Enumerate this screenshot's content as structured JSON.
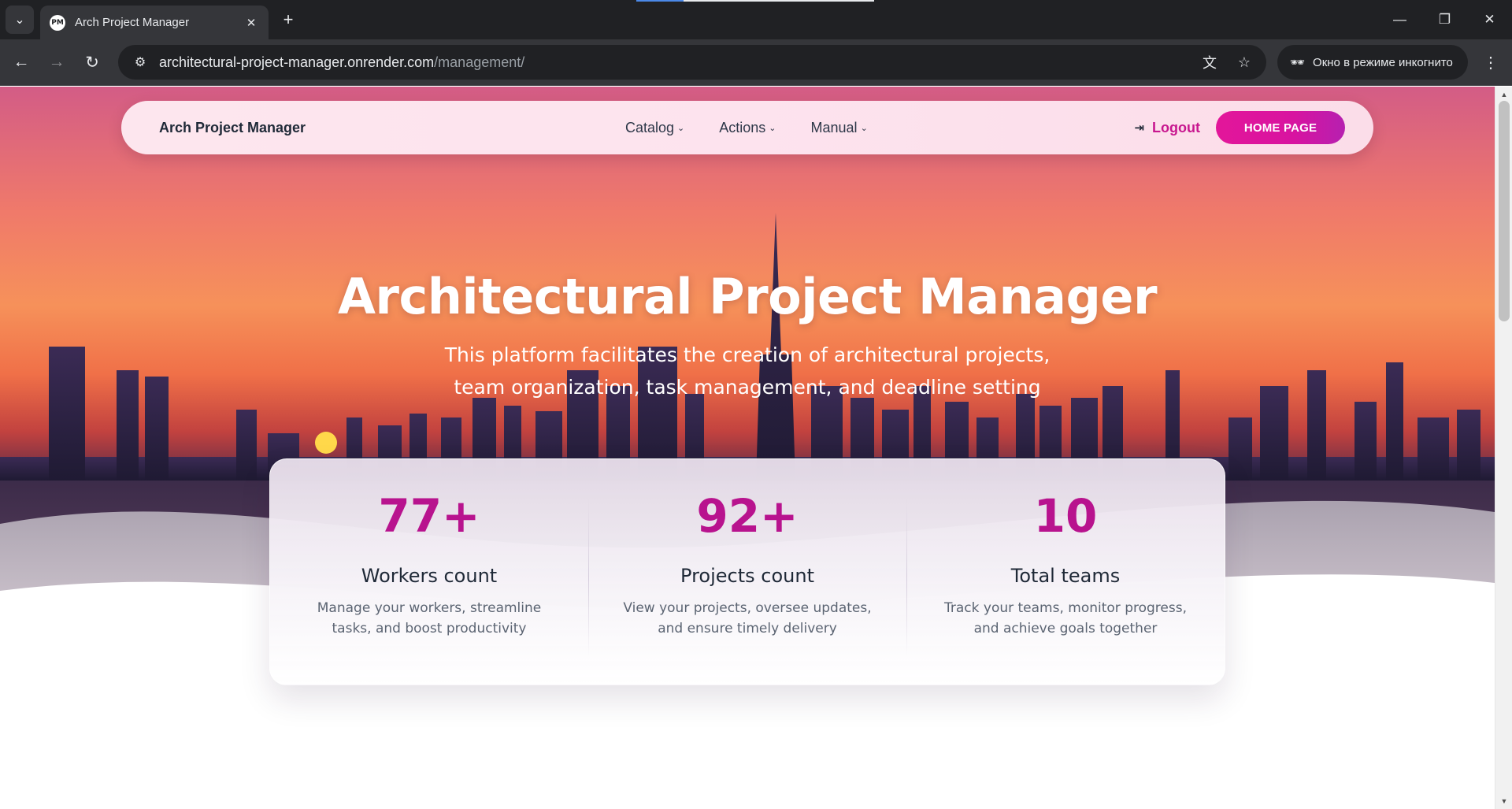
{
  "browser": {
    "tab_title": "Arch Project Manager",
    "tab_favicon_text": "PM",
    "url_host": "architectural-project-manager.onrender.com",
    "url_path": "/management/",
    "incognito_label": "Окно в режиме инкогнито"
  },
  "navbar": {
    "brand": "Arch Project Manager",
    "menu": [
      {
        "label": "Catalog"
      },
      {
        "label": "Actions"
      },
      {
        "label": "Manual"
      }
    ],
    "logout_label": "Logout",
    "home_button": "HOME PAGE"
  },
  "hero": {
    "title": "Architectural Project Manager",
    "subtitle": "This platform facilitates the creation of architectural projects, team organization, task management, and deadline setting"
  },
  "stats": [
    {
      "value": "77+",
      "label": "Workers count",
      "description": "Manage your workers, streamline tasks, and boost productivity"
    },
    {
      "value": "92+",
      "label": "Projects count",
      "description": "View your projects, oversee updates, and ensure timely delivery"
    },
    {
      "value": "10",
      "label": "Total teams",
      "description": "Track your teams, monitor progress, and achieve goals together"
    }
  ],
  "colors": {
    "accent": "#c8168f",
    "stat_number": "#b8138e",
    "button_gradient_start": "#e3169a",
    "button_gradient_end": "#b620b0"
  }
}
